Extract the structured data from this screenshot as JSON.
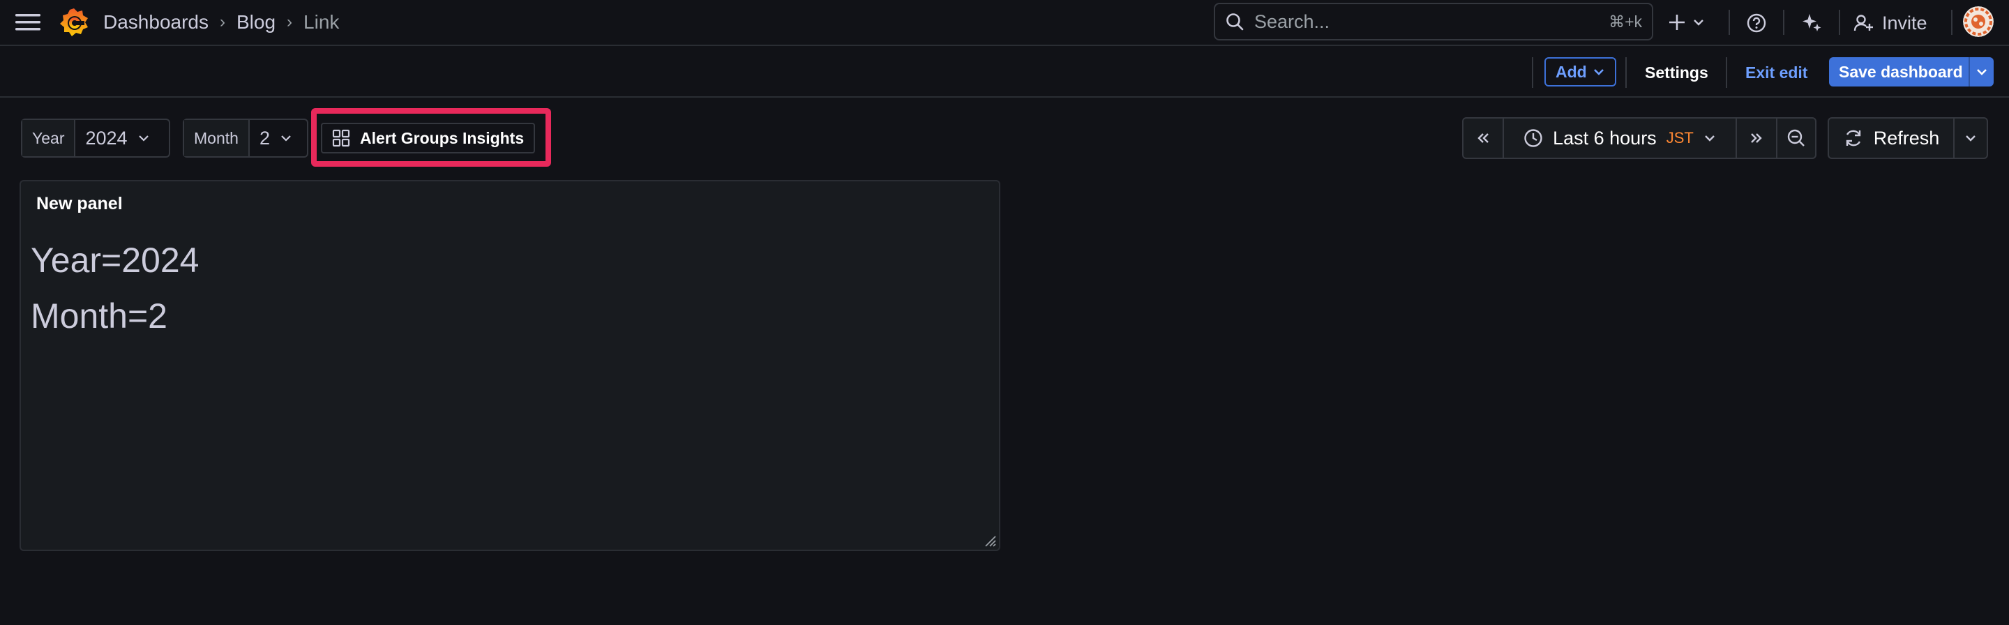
{
  "nav": {
    "breadcrumbs": [
      "Dashboards",
      "Blog",
      "Link"
    ],
    "search_placeholder": "Search...",
    "search_shortcut": "⌘+k",
    "invite_label": "Invite"
  },
  "toolbar": {
    "add_label": "Add",
    "settings_label": "Settings",
    "exit_edit_label": "Exit edit",
    "save_label": "Save dashboard"
  },
  "variables": [
    {
      "label": "Year",
      "value": "2024"
    },
    {
      "label": "Month",
      "value": "2"
    }
  ],
  "dashboard_link": {
    "label": "Alert Groups Insights",
    "icon": "apps-icon"
  },
  "time_picker": {
    "range": "Last 6 hours",
    "timezone": "JST"
  },
  "refresh": {
    "label": "Refresh"
  },
  "panel": {
    "title": "New panel",
    "lines": [
      "Year=2024",
      "Month=2"
    ]
  },
  "colors": {
    "background": "#111217",
    "primary": "#3d71d9",
    "timezone": "#ff8833",
    "highlight": "#e8295b"
  }
}
